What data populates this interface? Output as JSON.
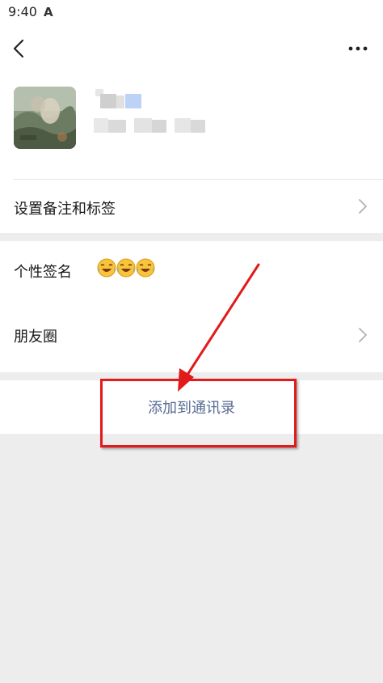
{
  "status_bar": {
    "time": "9:40",
    "indicator_glyph": "A"
  },
  "header": {
    "back_icon": "chevron-left-icon",
    "more_icon": "more-dots-icon"
  },
  "profile": {
    "avatar_icon": "avatar-painting"
  },
  "rows": {
    "remark_tags": {
      "label": "设置备注和标签"
    },
    "signature": {
      "label": "个性签名",
      "emoji_icons": [
        "laugh-cry-emoji",
        "laugh-cry-emoji",
        "laugh-cry-emoji"
      ]
    },
    "moments": {
      "label": "朋友圈"
    }
  },
  "actions": {
    "add_contact": "添加到通讯录"
  },
  "colors": {
    "link_blue": "#576b95",
    "annotation_red": "#e11a1a",
    "page_gray": "#ededed"
  }
}
